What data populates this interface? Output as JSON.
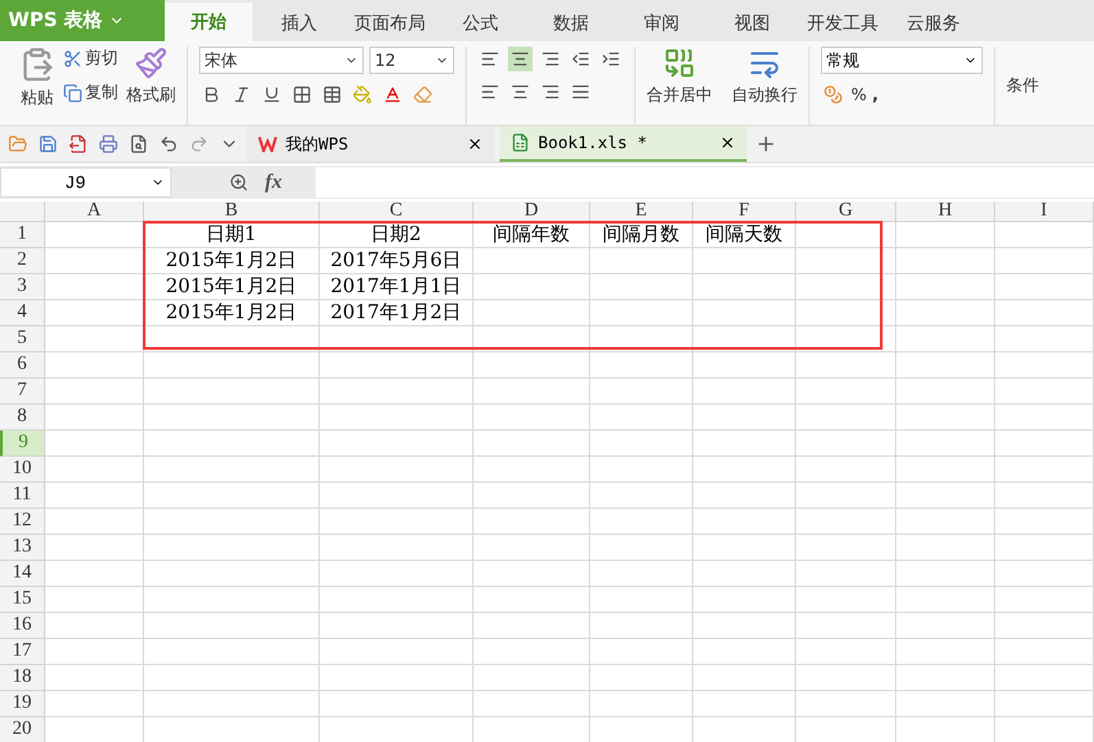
{
  "app": {
    "logo": "WPS 表格"
  },
  "tabs": [
    {
      "label": "开始",
      "selected": true
    },
    {
      "label": "插入",
      "selected": false
    },
    {
      "label": "页面布局",
      "selected": false
    },
    {
      "label": "公式",
      "selected": false
    },
    {
      "label": "数据",
      "selected": false
    },
    {
      "label": "审阅",
      "selected": false
    },
    {
      "label": "视图",
      "selected": false
    },
    {
      "label": "开发工具",
      "selected": false
    },
    {
      "label": "云服务",
      "selected": false
    }
  ],
  "clipboard": {
    "paste": "粘贴",
    "cut": "剪切",
    "copy": "复制",
    "format_painter": "格式刷"
  },
  "font": {
    "family": "宋体",
    "size": "12"
  },
  "align_buttons": [
    {
      "selected": false
    },
    {
      "selected": true
    },
    {
      "selected": false
    }
  ],
  "merge": {
    "merge_center": "合并居中",
    "wrap": "自动换行"
  },
  "number": {
    "format": "常规",
    "percent": "%",
    "comma": ","
  },
  "conditional": "条件",
  "doc_tabs": [
    {
      "label": "我的WPS",
      "kind": "home",
      "selected": false
    },
    {
      "label": "Book1.xls *",
      "kind": "sheet",
      "selected": true
    }
  ],
  "formula_bar": {
    "name_box": "J9",
    "fx": "fx"
  },
  "columns": [
    "A",
    "B",
    "C",
    "D",
    "E",
    "F",
    "G",
    "H",
    "I"
  ],
  "rows": [
    {
      "number": "1",
      "selected": false,
      "cells": {
        "B": "日期1",
        "C": "日期2",
        "D": "间隔年数",
        "E": "间隔月数",
        "F": "间隔天数"
      }
    },
    {
      "number": "2",
      "selected": false,
      "cells": {
        "B": "2015年1月2日",
        "C": "2017年5月6日"
      }
    },
    {
      "number": "3",
      "selected": false,
      "cells": {
        "B": "2015年1月2日",
        "C": "2017年1月1日"
      }
    },
    {
      "number": "4",
      "selected": false,
      "cells": {
        "B": "2015年1月2日",
        "C": "2017年1月2日"
      }
    },
    {
      "number": "5",
      "selected": false
    },
    {
      "number": "6",
      "selected": false
    },
    {
      "number": "7",
      "selected": false
    },
    {
      "number": "8",
      "selected": false
    },
    {
      "number": "9",
      "selected": true
    },
    {
      "number": "10",
      "selected": false
    },
    {
      "number": "11",
      "selected": false
    },
    {
      "number": "12",
      "selected": false
    },
    {
      "number": "13",
      "selected": false
    },
    {
      "number": "14",
      "selected": false
    },
    {
      "number": "15",
      "selected": false
    },
    {
      "number": "16",
      "selected": false
    },
    {
      "number": "17",
      "selected": false
    },
    {
      "number": "18",
      "selected": false
    },
    {
      "number": "19",
      "selected": false
    },
    {
      "number": "20",
      "selected": false
    }
  ]
}
